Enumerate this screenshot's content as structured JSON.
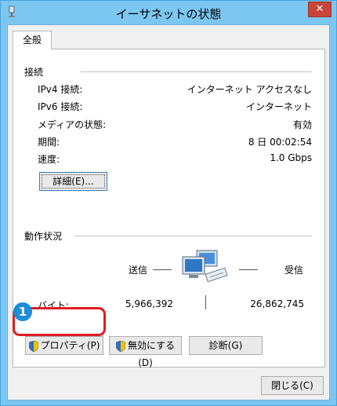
{
  "window": {
    "title": "イーサネットの状態",
    "close_symbol": "✕"
  },
  "tab": {
    "label": "全般"
  },
  "connection": {
    "section_title": "接続",
    "rows": [
      {
        "label": "IPv4 接続:",
        "value": "インターネット アクセスなし"
      },
      {
        "label": "IPv6 接続:",
        "value": "インターネット"
      },
      {
        "label": "メディアの状態:",
        "value": "有効"
      },
      {
        "label": "期間:",
        "value": "8 日 00:02:54"
      },
      {
        "label": "速度:",
        "value": "1.0 Gbps"
      }
    ],
    "details_button": "詳細(E)..."
  },
  "activity": {
    "section_title": "動作状況",
    "sent_label": "送信",
    "received_label": "受信",
    "bytes_label": "バイト:",
    "bytes_sent": "5,966,392",
    "bytes_received": "26,862,745"
  },
  "buttons": {
    "properties": "プロパティ(P)",
    "disable": "無効にする(D)",
    "diagnose": "診断(G)",
    "close": "閉じる(C)"
  },
  "annotation": {
    "badge": "1"
  },
  "colors": {
    "frame": "#7cc7f2",
    "highlight": "#e21b22",
    "badge": "#1b8ed6"
  },
  "icons": [
    "network-status-icon",
    "shield-icon",
    "network-computers-icon"
  ]
}
